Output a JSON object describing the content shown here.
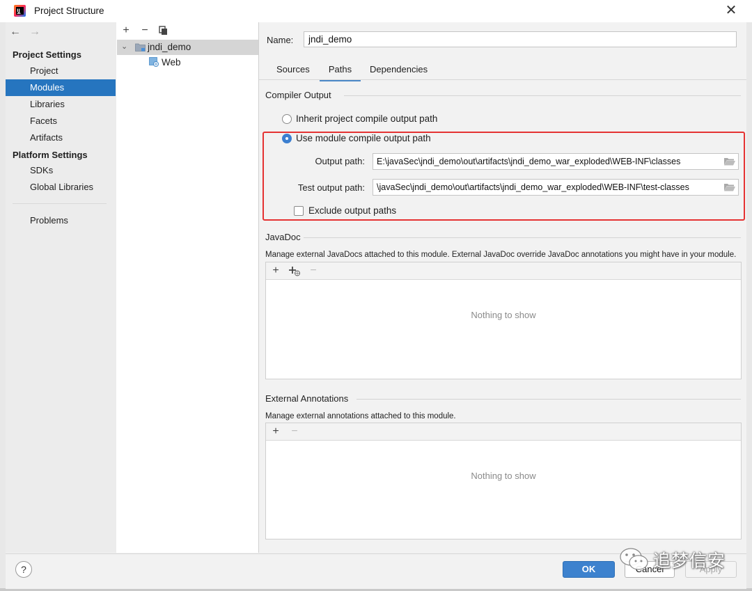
{
  "window": {
    "title": "Project Structure"
  },
  "sidebar": {
    "sections": [
      {
        "header": "Project Settings",
        "items": [
          "Project",
          "Modules",
          "Libraries",
          "Facets",
          "Artifacts"
        ]
      },
      {
        "header": "Platform Settings",
        "items": [
          "SDKs",
          "Global Libraries"
        ]
      }
    ],
    "problems": "Problems",
    "selected": "Modules"
  },
  "tree": {
    "root": "jndi_demo",
    "child": "Web"
  },
  "module": {
    "name_label": "Name:",
    "name_value": "jndi_demo",
    "tabs": [
      "Sources",
      "Paths",
      "Dependencies"
    ],
    "active_tab": "Paths"
  },
  "compiler_output": {
    "title": "Compiler Output",
    "inherit_label": "Inherit project compile output path",
    "use_module_label": "Use module compile output path",
    "selected": "use_module",
    "output_label": "Output path:",
    "output_value": "E:\\javaSec\\jndi_demo\\out\\artifacts\\jndi_demo_war_exploded\\WEB-INF\\classes",
    "test_output_label": "Test output path:",
    "test_output_value": "\\javaSec\\jndi_demo\\out\\artifacts\\jndi_demo_war_exploded\\WEB-INF\\test-classes",
    "exclude_label": "Exclude output paths",
    "exclude_checked": false
  },
  "javadoc": {
    "title": "JavaDoc",
    "description": "Manage external JavaDocs attached to this module. External JavaDoc override JavaDoc annotations you might have in your module.",
    "empty_text": "Nothing to show"
  },
  "annotations": {
    "title": "External Annotations",
    "description": "Manage external annotations attached to this module.",
    "empty_text": "Nothing to show"
  },
  "footer": {
    "help": "?",
    "ok": "OK",
    "cancel": "Cancel",
    "apply": "Apply"
  },
  "watermark": {
    "text": "追梦信安"
  },
  "colors": {
    "selection": "#2675bf",
    "highlight_box": "#e53232",
    "ok_button": "#3d82ce"
  }
}
